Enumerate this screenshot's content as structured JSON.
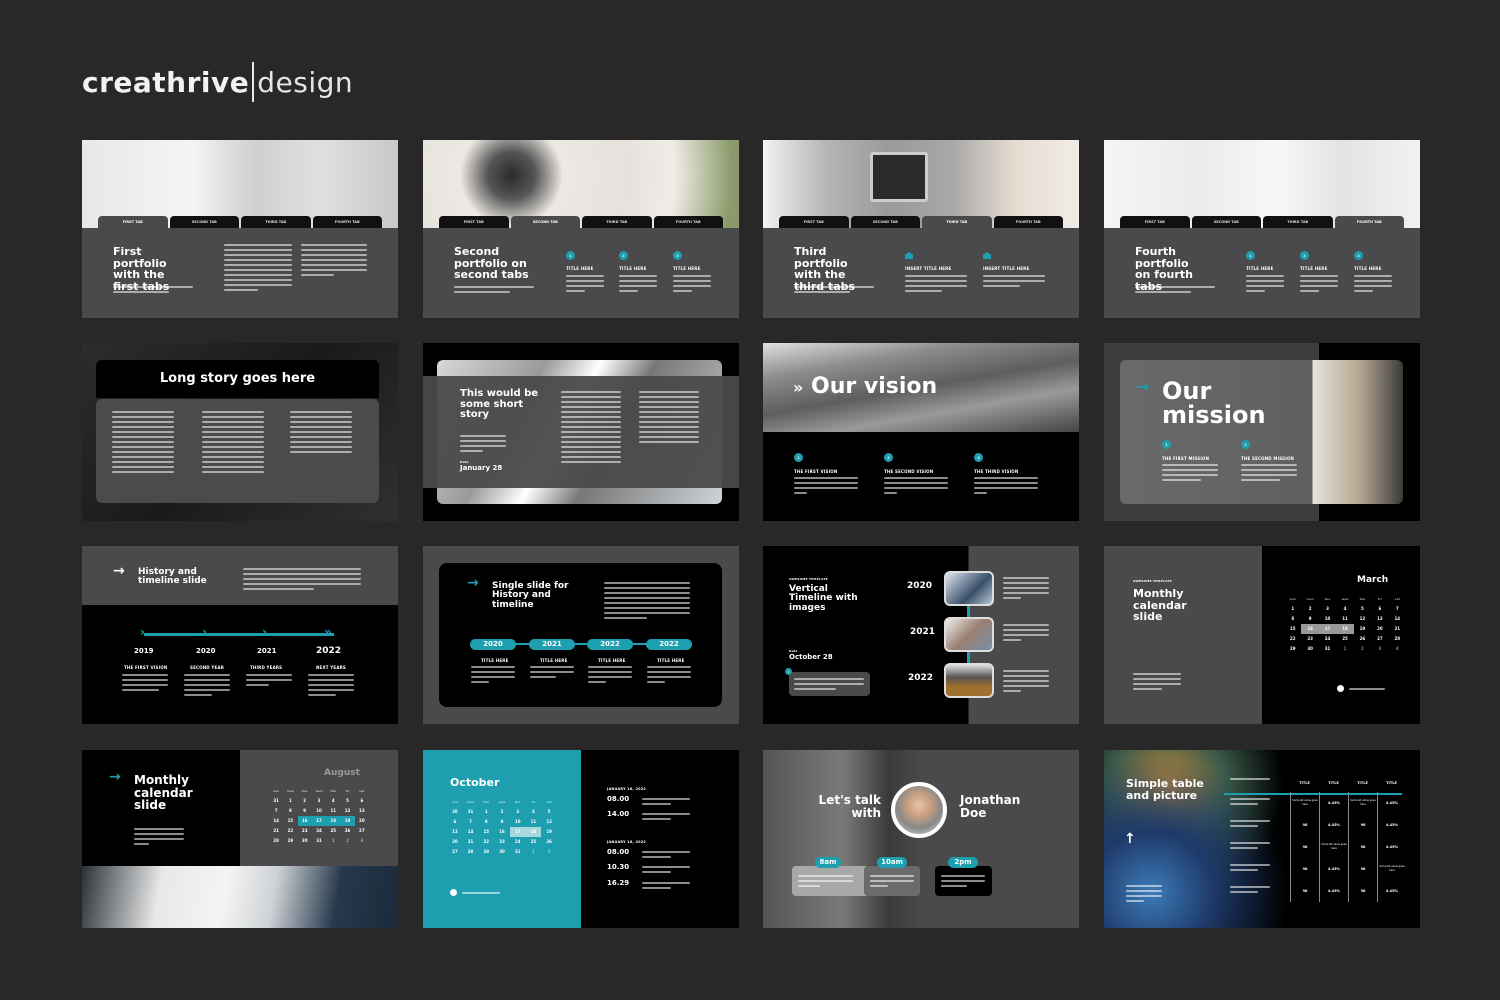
{
  "brand": {
    "name_bold": "creathrive",
    "name_light": "design"
  },
  "colors": {
    "background": "#282828",
    "accent": "#1e9fb0",
    "slide_gray": "#4a4a4c",
    "slide_black": "#000000"
  },
  "slides": [
    {
      "id": "first-portfolio",
      "title": "First portfolio with the first tabs",
      "tabs": [
        "FIRST TAB",
        "SECOND TAB",
        "THIRD TAB",
        "FOURTH TAB"
      ],
      "active_tab": 0
    },
    {
      "id": "second-portfolio",
      "title": "Second portfolio on second tabs",
      "tabs": [
        "FIRST TAB",
        "SECOND TAB",
        "THIRD TAB",
        "FOURTH TAB"
      ],
      "active_tab": 1,
      "items": [
        {
          "num": "1",
          "label": "TITLE HERE"
        },
        {
          "num": "2",
          "label": "TITLE HERE"
        },
        {
          "num": "3",
          "label": "TITLE HERE"
        }
      ]
    },
    {
      "id": "third-portfolio",
      "title": "Third portfolio with the third tabs",
      "tabs": [
        "FIRST TAB",
        "SECOND TAB",
        "THIRD TAB",
        "FOURTH TAB"
      ],
      "active_tab": 2,
      "items": [
        {
          "label": "INSERT TITLE HERE"
        },
        {
          "label": "INSERT TITLE HERE"
        }
      ]
    },
    {
      "id": "fourth-portfolio",
      "title": "Fourth portfolio on fourth tabs",
      "tabs": [
        "FIRST TAB",
        "SECOND TAB",
        "THIRD TAB",
        "FOURTH TAB"
      ],
      "active_tab": 3,
      "items": [
        {
          "num": "1",
          "label": "TITLE HERE"
        },
        {
          "num": "2",
          "label": "TITLE HERE"
        },
        {
          "num": "3",
          "label": "TITLE HERE"
        }
      ]
    },
    {
      "id": "long-story",
      "title": "Long story goes here"
    },
    {
      "id": "short-story",
      "title": "This would be some short story",
      "date_label": "Date",
      "date": "January 28"
    },
    {
      "id": "our-vision",
      "title": "Our vision",
      "items": [
        {
          "num": "1",
          "label": "THE FIRST VISION"
        },
        {
          "num": "2",
          "label": "THE SECOND VISION"
        },
        {
          "num": "3",
          "label": "THE THIRD VISION"
        }
      ]
    },
    {
      "id": "our-mission",
      "title_line1": "Our",
      "title_line2": "mission",
      "items": [
        {
          "num": "1",
          "label": "THE FIRST MISSION"
        },
        {
          "num": "2",
          "label": "THE SECOND MISSION"
        }
      ]
    },
    {
      "id": "history-timeline",
      "title": "History and timeline slide",
      "years": [
        "2019",
        "2020",
        "2021",
        "2022"
      ],
      "labels": [
        "THE FIRST VISION",
        "SECOND YEAR",
        "THIRD YEARS",
        "NEXT YEARS"
      ]
    },
    {
      "id": "single-history",
      "title": "Single slide for History and timeline",
      "years": [
        "2020",
        "2021",
        "2022",
        "2022"
      ],
      "labels": [
        "TITLE HERE",
        "TITLE HERE",
        "TITLE HERE",
        "TITLE HERE"
      ]
    },
    {
      "id": "vertical-timeline",
      "eyebrow": "AWESOME TEMPLATE",
      "title": "Vertical Timeline with images",
      "date_label": "Date",
      "date": "October 28",
      "years": [
        "2020",
        "2021",
        "2022"
      ]
    },
    {
      "id": "monthly-calendar-march",
      "eyebrow": "AWESOME TEMPLATE",
      "title": "Monthly calendar slide",
      "month": "March",
      "weekdays": [
        "sun",
        "mon",
        "tue",
        "wed",
        "thu",
        "fri",
        "sat"
      ],
      "days": [
        "1",
        "2",
        "3",
        "4",
        "5",
        "6",
        "7",
        "8",
        "9",
        "10",
        "11",
        "12",
        "13",
        "14",
        "15",
        "16",
        "17",
        "18",
        "19",
        "20",
        "21",
        "22",
        "23",
        "24",
        "25",
        "26",
        "27",
        "28",
        "29",
        "30",
        "31",
        "1",
        "2",
        "3",
        "4"
      ],
      "highlight": [
        "16",
        "17",
        "18"
      ]
    },
    {
      "id": "monthly-calendar-august",
      "title": "Monthly calendar slide",
      "month": "August",
      "weekdays": [
        "sun",
        "mon",
        "tue",
        "wed",
        "thu",
        "fri",
        "sat"
      ],
      "days": [
        "31",
        "1",
        "2",
        "3",
        "4",
        "5",
        "6",
        "7",
        "8",
        "9",
        "10",
        "11",
        "12",
        "13",
        "14",
        "15",
        "16",
        "17",
        "18",
        "19",
        "20",
        "21",
        "22",
        "23",
        "24",
        "25",
        "26",
        "27",
        "28",
        "29",
        "30",
        "31",
        "1",
        "2",
        "3"
      ],
      "highlight": [
        "16",
        "17",
        "18",
        "19"
      ]
    },
    {
      "id": "october-schedule",
      "month": "October",
      "weekdays": [
        "sun",
        "mon",
        "tue",
        "wed",
        "thu",
        "fri",
        "sat"
      ],
      "days": [
        "30",
        "31",
        "1",
        "2",
        "3",
        "4",
        "5",
        "6",
        "7",
        "8",
        "9",
        "10",
        "11",
        "12",
        "13",
        "14",
        "15",
        "16",
        "17",
        "18",
        "19",
        "20",
        "21",
        "22",
        "23",
        "24",
        "25",
        "26",
        "27",
        "28",
        "29",
        "30",
        "31",
        "1",
        "2"
      ],
      "highlight": [
        "17",
        "18"
      ],
      "schedule": [
        {
          "date": "JANUARY 16, 2022",
          "times": [
            "08.00",
            "14.00"
          ]
        },
        {
          "date": "JANUARY 16, 2022",
          "times": [
            "08.00",
            "10.30",
            "16.29"
          ]
        }
      ]
    },
    {
      "id": "lets-talk",
      "title": "Let's talk with",
      "name": "Jonathan Doe",
      "times": [
        "8am",
        "10am",
        "2pm"
      ]
    },
    {
      "id": "table-picture",
      "title": "Simple table and picture",
      "headers": [
        "TITLE",
        "TITLE",
        "TITLE",
        "TITLE"
      ],
      "rows": [
        [
          "Some alt value goes here",
          "4.45%",
          "Some alt value goes here",
          "4.45%"
        ],
        [
          "98",
          "4.45%",
          "98",
          "4.45%"
        ],
        [
          "98",
          "Some alt value goes here",
          "98",
          "4.45%"
        ],
        [
          "98",
          "4.45%",
          "98",
          "Some alt value goes here"
        ],
        [
          "98",
          "4.45%",
          "98",
          "4.45%"
        ]
      ]
    }
  ]
}
